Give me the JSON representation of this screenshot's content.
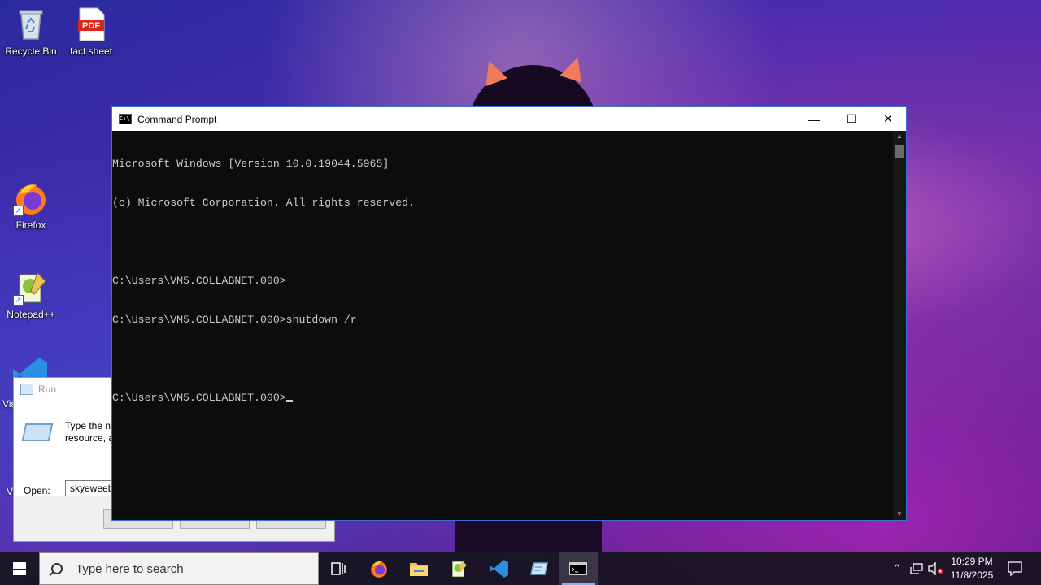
{
  "desktop": {
    "icons": [
      {
        "label": "Recycle Bin",
        "icon": "recycle-bin-icon"
      },
      {
        "label": "fact sheet",
        "icon": "pdf-file-icon",
        "badge": "PDF"
      },
      {
        "label": "Firefox",
        "icon": "firefox-icon"
      },
      {
        "label": "Notepad++",
        "icon": "notepad-plus-plus-icon"
      }
    ],
    "partial_labels": {
      "vs": "Vis",
      "v": "V"
    }
  },
  "run_dialog": {
    "title": "Run",
    "description_line1": "Type the na",
    "description_line2": "resource, a",
    "open_label": "Open:",
    "open_value": "skyeweeb"
  },
  "cmd_window": {
    "title": "Command Prompt",
    "icon_glyph": "C:\\",
    "controls": {
      "minimize": "—",
      "maximize": "☐",
      "close": "✕"
    },
    "lines": [
      "Microsoft Windows [Version 10.0.19044.5965]",
      "(c) Microsoft Corporation. All rights reserved.",
      "",
      "C:\\Users\\VM5.COLLABNET.000>",
      "C:\\Users\\VM5.COLLABNET.000>shutdown /r",
      "",
      "C:\\Users\\VM5.COLLABNET.000>"
    ]
  },
  "taskbar": {
    "search_placeholder": "Type here to search",
    "apps": [
      "task-view-icon",
      "firefox-icon",
      "file-explorer-icon",
      "notepad-plus-plus-icon",
      "vscode-icon",
      "run-icon",
      "command-prompt-icon"
    ],
    "active_app": "command-prompt-icon",
    "time": "10:29 PM",
    "date": "11/8/2025",
    "colors": {
      "accent": "#7fb3ff"
    }
  }
}
